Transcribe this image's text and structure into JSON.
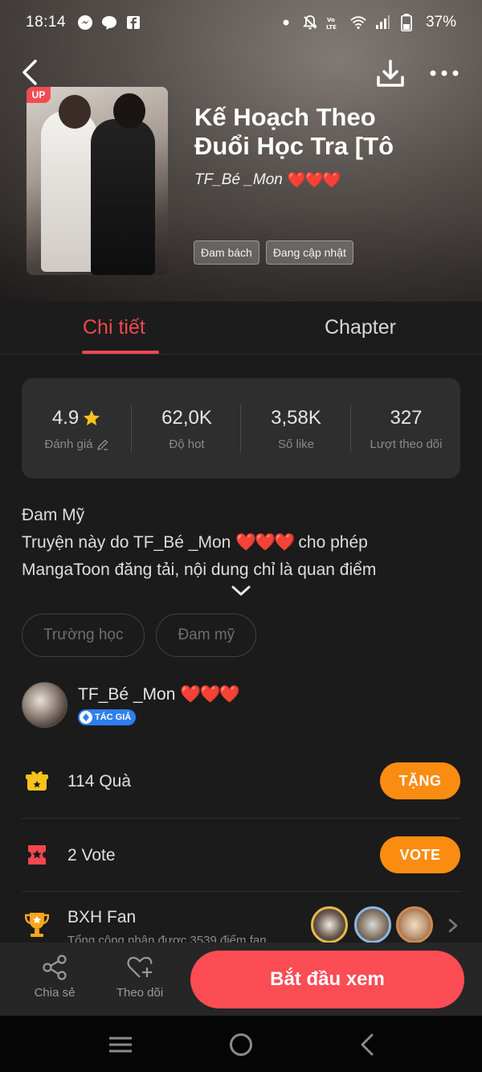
{
  "status_bar": {
    "time": "18:14",
    "battery": "37%"
  },
  "book": {
    "up_badge": "UP",
    "title_line1": "Kế Hoạch Theo",
    "title_line2": "Đuổi Học Tra [Tô",
    "author": "TF_Bé _Mon",
    "hearts": "❤️❤️❤️",
    "genre_tags": [
      "Đam bách",
      "Đang cập nhật"
    ]
  },
  "tabs": {
    "detail": "Chi tiết",
    "chapter": "Chapter"
  },
  "stats": {
    "rating_value": "4.9",
    "rating_label": "Đánh giá",
    "hot_value": "62,0K",
    "hot_label": "Độ hot",
    "likes_value": "3,58K",
    "likes_label": "Số like",
    "follows_value": "327",
    "follows_label": "Lượt theo dõi"
  },
  "description": {
    "line1": "Đam Mỹ",
    "line2_prefix": "Truyện này do TF_Bé _Mon ",
    "line2_suffix": " cho phép",
    "line3": "MangaToon đăng tải, nội dung chỉ là quan điểm"
  },
  "topic_tags": [
    "Trường học",
    "Đam mỹ"
  ],
  "author_row": {
    "name": "TF_Bé _Mon",
    "badge": "TÁC GIẢ"
  },
  "gifts": {
    "label": "114 Quà",
    "button": "TẶNG"
  },
  "votes": {
    "label": "2 Vote",
    "button": "VOTE"
  },
  "fan_ranking": {
    "title": "BXH Fan",
    "subtitle": "Tổng cộng nhận được 3539 điểm fan"
  },
  "action_bar": {
    "share": "Chia sẻ",
    "follow": "Theo dõi",
    "start": "Bắt đầu xem"
  },
  "colors": {
    "accent_red": "#f2474f",
    "button_orange": "#fb8c12",
    "start_button": "#fc4c54",
    "badge_blue": "#2d7ff0"
  }
}
